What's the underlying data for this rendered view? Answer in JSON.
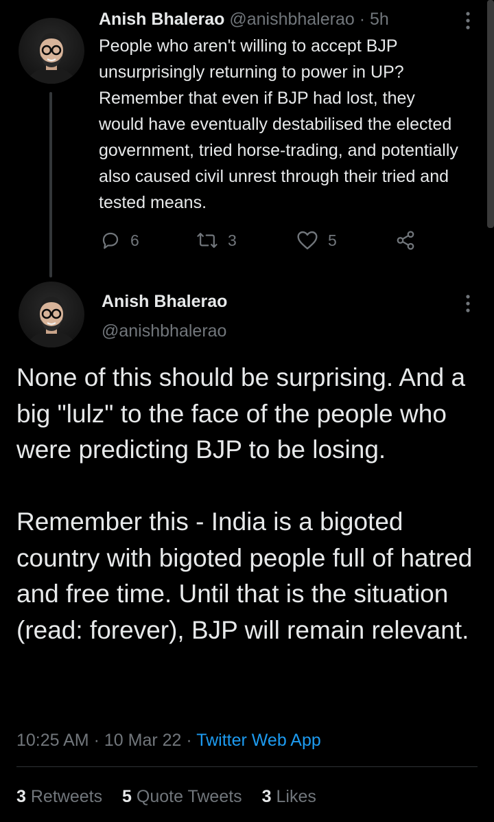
{
  "parent_tweet": {
    "author_name": "Anish Bhalerao",
    "handle": "@anishbhalerao",
    "time": "5h",
    "separator": "·",
    "text": "People who aren't willing to accept BJP unsurprisingly returning to power in UP? Remember that even if BJP had lost, they would have eventually destabilised the elected government, tried horse-trading, and potentially also caused civil unrest through their tried and tested means.",
    "replies": "6",
    "retweets": "3",
    "likes": "5",
    "icons": {
      "more": "more-vertical-icon",
      "reply": "reply-icon",
      "retweet": "retweet-icon",
      "like": "heart-icon",
      "share": "share-icon"
    }
  },
  "main_tweet": {
    "author_name": "Anish Bhalerao",
    "handle": "@anishbhalerao",
    "paragraph_1": "None of this should be surprising. And a big \"lulz\" to the face of the people who were predicting BJP to be losing.",
    "paragraph_2": "Remember this - India is a bigoted country with bigoted people full of hatred and free time. Until that is the situation (read: forever), BJP will remain relevant.",
    "time": "10:25 AM",
    "date": "10 Mar 22",
    "separator": "·",
    "source": "Twitter Web App",
    "stats": {
      "retweets_count": "3",
      "retweets_label": "Retweets",
      "quotes_count": "5",
      "quotes_label": "Quote Tweets",
      "likes_count": "3",
      "likes_label": "Likes"
    }
  },
  "colors": {
    "background": "#000000",
    "text_primary": "#e7e9ea",
    "text_secondary": "#71767b",
    "link": "#1d9bf0",
    "divider": "#2f3336"
  }
}
